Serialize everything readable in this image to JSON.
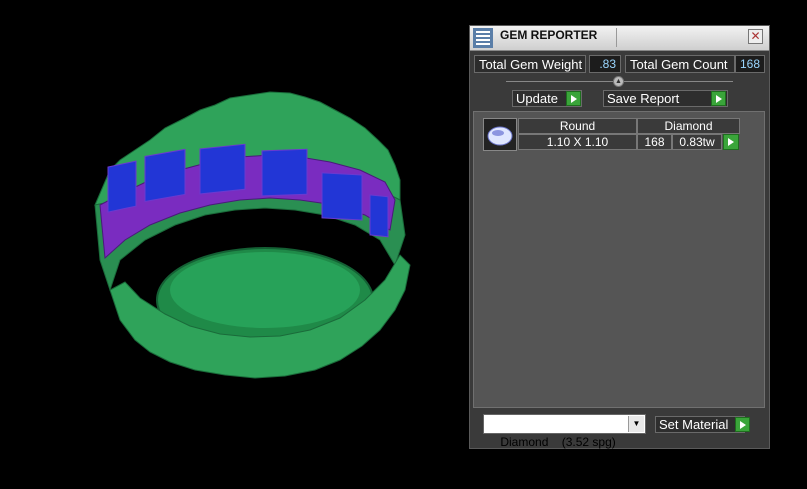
{
  "panel": {
    "title": "GEM REPORTER",
    "close_glyph": "✕",
    "total_weight_label": "Total Gem Weight",
    "total_weight_value": ".83",
    "total_count_label": "Total Gem Count",
    "total_count_value": "168",
    "update_label": "Update",
    "save_report_label": "Save Report",
    "set_material_label": "Set Material",
    "material_select": "Diamond    (3.52 spg)"
  },
  "gems": {
    "columns": [
      "Round",
      "Diamond"
    ],
    "rows": [
      {
        "size": "1.10 X 1.10",
        "count": "168",
        "weight": "0.83tw"
      }
    ]
  },
  "colors": {
    "metal": "#2fa35a",
    "prongs": "#8a2fcf",
    "stones": "#2236d6",
    "accent_play": "#3aa53a"
  },
  "icons": [
    "app-icon",
    "close-icon",
    "slider-knob",
    "play-icon",
    "gem-thumbnail-icon",
    "dropdown-arrow-icon"
  ]
}
